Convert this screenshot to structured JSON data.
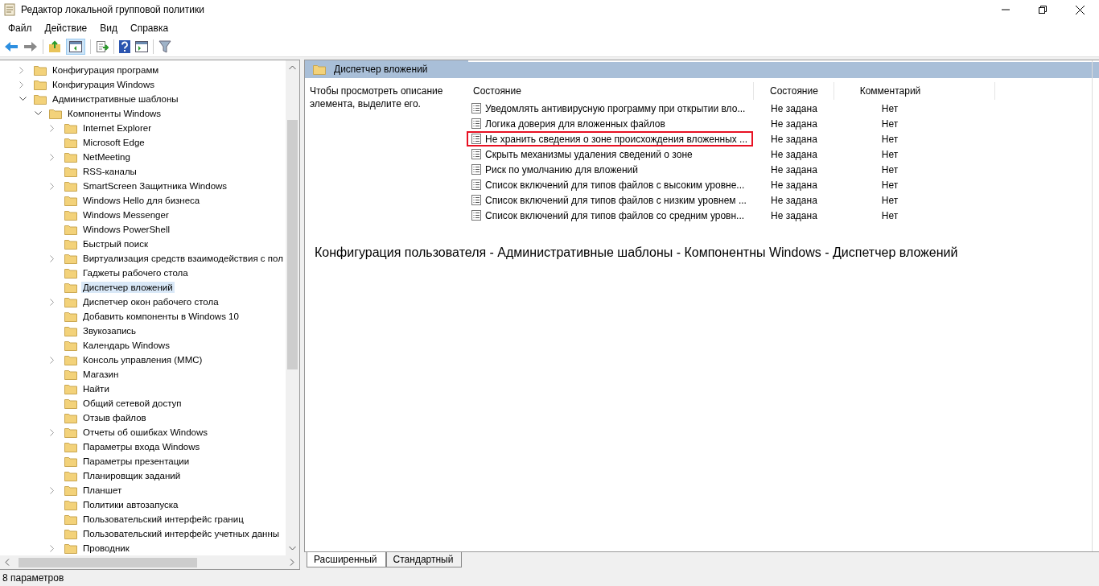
{
  "window": {
    "title": "Редактор локальной групповой политики"
  },
  "menu": [
    "Файл",
    "Действие",
    "Вид",
    "Справка"
  ],
  "tree": [
    {
      "label": "Конфигурация программ",
      "expandable": true,
      "expanded": false,
      "selected": false
    },
    {
      "label": "Конфигурация Windows",
      "expandable": true,
      "expanded": false,
      "selected": false
    },
    {
      "label": "Административные шаблоны",
      "expandable": true,
      "expanded": true,
      "selected": false,
      "children": [
        {
          "label": "Компоненты Windows",
          "expandable": true,
          "expanded": true,
          "selected": false,
          "children": [
            {
              "label": "Internet Explorer",
              "expandable": true,
              "expanded": false,
              "selected": false
            },
            {
              "label": "Microsoft Edge",
              "expandable": false,
              "expanded": false,
              "selected": false
            },
            {
              "label": "NetMeeting",
              "expandable": true,
              "expanded": false,
              "selected": false
            },
            {
              "label": "RSS-каналы",
              "expandable": false,
              "expanded": false,
              "selected": false
            },
            {
              "label": "SmartScreen Защитника Windows",
              "expandable": true,
              "expanded": false,
              "selected": false
            },
            {
              "label": "Windows Hello для бизнеса",
              "expandable": false,
              "expanded": false,
              "selected": false
            },
            {
              "label": "Windows Messenger",
              "expandable": false,
              "expanded": false,
              "selected": false
            },
            {
              "label": "Windows PowerShell",
              "expandable": false,
              "expanded": false,
              "selected": false
            },
            {
              "label": "Быстрый поиск",
              "expandable": false,
              "expanded": false,
              "selected": false
            },
            {
              "label": "Виртуализация средств взаимодействия с пол",
              "expandable": true,
              "expanded": false,
              "selected": false
            },
            {
              "label": "Гаджеты рабочего стола",
              "expandable": false,
              "expanded": false,
              "selected": false
            },
            {
              "label": "Диспетчер вложений",
              "expandable": false,
              "expanded": false,
              "selected": true
            },
            {
              "label": "Диспетчер окон рабочего стола",
              "expandable": true,
              "expanded": false,
              "selected": false
            },
            {
              "label": "Добавить компоненты в Windows 10",
              "expandable": false,
              "expanded": false,
              "selected": false
            },
            {
              "label": "Звукозапись",
              "expandable": false,
              "expanded": false,
              "selected": false
            },
            {
              "label": "Календарь Windows",
              "expandable": false,
              "expanded": false,
              "selected": false
            },
            {
              "label": "Консоль управления (MMC)",
              "expandable": true,
              "expanded": false,
              "selected": false
            },
            {
              "label": "Магазин",
              "expandable": false,
              "expanded": false,
              "selected": false
            },
            {
              "label": "Найти",
              "expandable": false,
              "expanded": false,
              "selected": false
            },
            {
              "label": "Общий сетевой доступ",
              "expandable": false,
              "expanded": false,
              "selected": false
            },
            {
              "label": "Отзыв файлов",
              "expandable": false,
              "expanded": false,
              "selected": false
            },
            {
              "label": "Отчеты об ошибках Windows",
              "expandable": true,
              "expanded": false,
              "selected": false
            },
            {
              "label": "Параметры входа Windows",
              "expandable": false,
              "expanded": false,
              "selected": false
            },
            {
              "label": "Параметры презентации",
              "expandable": false,
              "expanded": false,
              "selected": false
            },
            {
              "label": "Планировщик заданий",
              "expandable": false,
              "expanded": false,
              "selected": false
            },
            {
              "label": "Планшет",
              "expandable": true,
              "expanded": false,
              "selected": false
            },
            {
              "label": "Политики автозапуска",
              "expandable": false,
              "expanded": false,
              "selected": false
            },
            {
              "label": "Пользовательский интерфейс границ",
              "expandable": false,
              "expanded": false,
              "selected": false
            },
            {
              "label": "Пользовательский интерфейс учетных данны",
              "expandable": false,
              "expanded": false,
              "selected": false
            },
            {
              "label": "Проводник",
              "expandable": true,
              "expanded": false,
              "selected": false
            }
          ]
        }
      ]
    }
  ],
  "details": {
    "title": "Диспетчер вложений",
    "description": "Чтобы просмотреть описание элемента, выделите его.",
    "columns": [
      "Состояние",
      "Состояние",
      "Комментарий"
    ],
    "rows": [
      {
        "name": "Уведомлять антивирусную программу при открытии вло...",
        "state": "Не задана",
        "comment": "Нет",
        "highlighted": false
      },
      {
        "name": "Логика доверия для вложенных файлов",
        "state": "Не задана",
        "comment": "Нет",
        "highlighted": false
      },
      {
        "name": "Не хранить сведения о зоне происхождения вложенных ...",
        "state": "Не задана",
        "comment": "Нет",
        "highlighted": true
      },
      {
        "name": "Скрыть механизмы удаления сведений о зоне",
        "state": "Не задана",
        "comment": "Нет",
        "highlighted": false
      },
      {
        "name": "Риск по умолчанию для вложений",
        "state": "Не задана",
        "comment": "Нет",
        "highlighted": false
      },
      {
        "name": "Список включений для типов файлов с высоким уровне...",
        "state": "Не задана",
        "comment": "Нет",
        "highlighted": false
      },
      {
        "name": "Список включений для типов файлов с низким уровнем ...",
        "state": "Не задана",
        "comment": "Нет",
        "highlighted": false
      },
      {
        "name": "Список включений для типов файлов со средним уровн...",
        "state": "Не задана",
        "comment": "Нет",
        "highlighted": false
      }
    ],
    "path": "Конфигурация пользователя - Административные шаблоны - Компонентны Windows - Диспетчер вложений",
    "tabs": [
      {
        "label": "Расширенный",
        "selected": true
      },
      {
        "label": "Стандартный",
        "selected": false
      }
    ]
  },
  "status_bar": "8 параметров"
}
